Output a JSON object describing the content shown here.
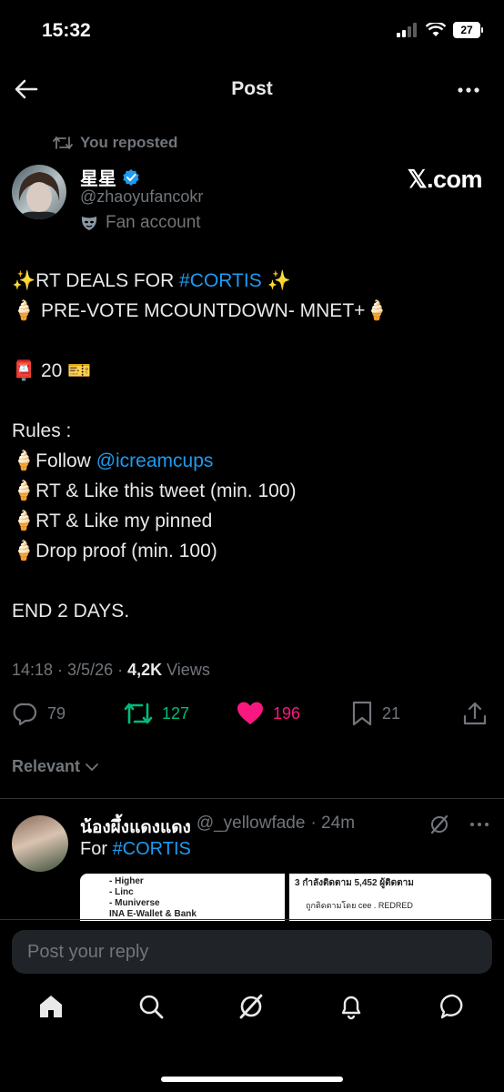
{
  "status_bar": {
    "time": "15:32",
    "battery": "27"
  },
  "header": {
    "title": "Post"
  },
  "repost": {
    "label": "You reposted"
  },
  "author": {
    "display_name": "星星",
    "handle": "@zhaoyufancokr",
    "label": "Fan account",
    "source": "𝕏.com"
  },
  "tweet": {
    "line1_pre": "RT DEALS FOR ",
    "line1_tag": "#CORTIS",
    "line2": "PRE-VOTE MCOUNTDOWN- MNET+",
    "line3": "20",
    "rules_title": "Rules :",
    "rule1_pre": "Follow ",
    "rule1_mention": "@icreamcups",
    "rule2": "RT & Like this tweet (min. 100)",
    "rule3": "RT & Like my pinned",
    "rule4": "Drop proof (min. 100)",
    "end": "END 2 DAYS."
  },
  "meta": {
    "time_date": "14:18 · 3/5/26 · ",
    "views_count": "4,2K",
    "views_label": " Views"
  },
  "actions": {
    "replies": "79",
    "reposts": "127",
    "likes": "196",
    "bookmarks": "21"
  },
  "sort": {
    "label": "Relevant"
  },
  "reply": {
    "name": "น้องผึ้งแดงแดง",
    "handle": "@_yellowfade",
    "time": "· 24m",
    "text_pre": "For ",
    "text_tag": "#CORTIS",
    "image1_lines": [
      "- Higher",
      "- Linc",
      "- Muniverse",
      "INA E-Wallet & Bank"
    ],
    "image2_lines": [
      "3 กำลังติดตาม   5,452 ผู้ติดตาม",
      "ถูกติดตามโดย cee . REDRED"
    ]
  },
  "reply_box": {
    "placeholder": "Post your reply"
  },
  "colors": {
    "accent": "#1d9bf0",
    "repost_green": "#00ba7c",
    "like_pink": "#f91880",
    "background": "#000000"
  }
}
